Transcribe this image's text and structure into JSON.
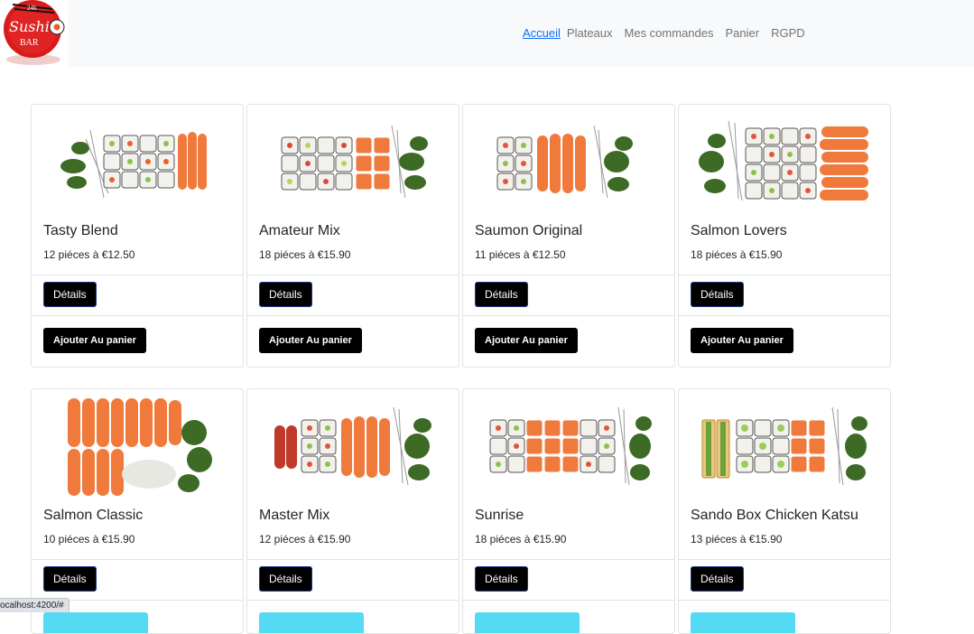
{
  "logo": {
    "line1": "24h",
    "line2": "Sushi",
    "line3": "BAR"
  },
  "nav": [
    {
      "label": "Accueil",
      "active": true
    },
    {
      "label": "Plateaux"
    },
    {
      "label": "Mes commandes"
    },
    {
      "label": "Panier"
    },
    {
      "label": "RGPD"
    }
  ],
  "buttons": {
    "details": "Détails",
    "add_to_cart": "Ajouter Au panier"
  },
  "products": [
    {
      "name": "Tasty Blend",
      "price": "12 piéces à €12.50"
    },
    {
      "name": "Amateur Mix",
      "price": "18 piéces à €15.90"
    },
    {
      "name": "Saumon Original",
      "price": "11 piéces à €12.50"
    },
    {
      "name": "Salmon Lovers",
      "price": "18 piéces à €15.90"
    },
    {
      "name": "Salmon Classic",
      "price": "10 piéces à €15.90"
    },
    {
      "name": "Master Mix",
      "price": "12 piéces à €15.90"
    },
    {
      "name": "Sunrise",
      "price": "18 piéces à €15.90"
    },
    {
      "name": "Sando Box Chicken Katsu",
      "price": "13 piéces à €15.90"
    }
  ],
  "status_url": "ocalhost:4200/#"
}
